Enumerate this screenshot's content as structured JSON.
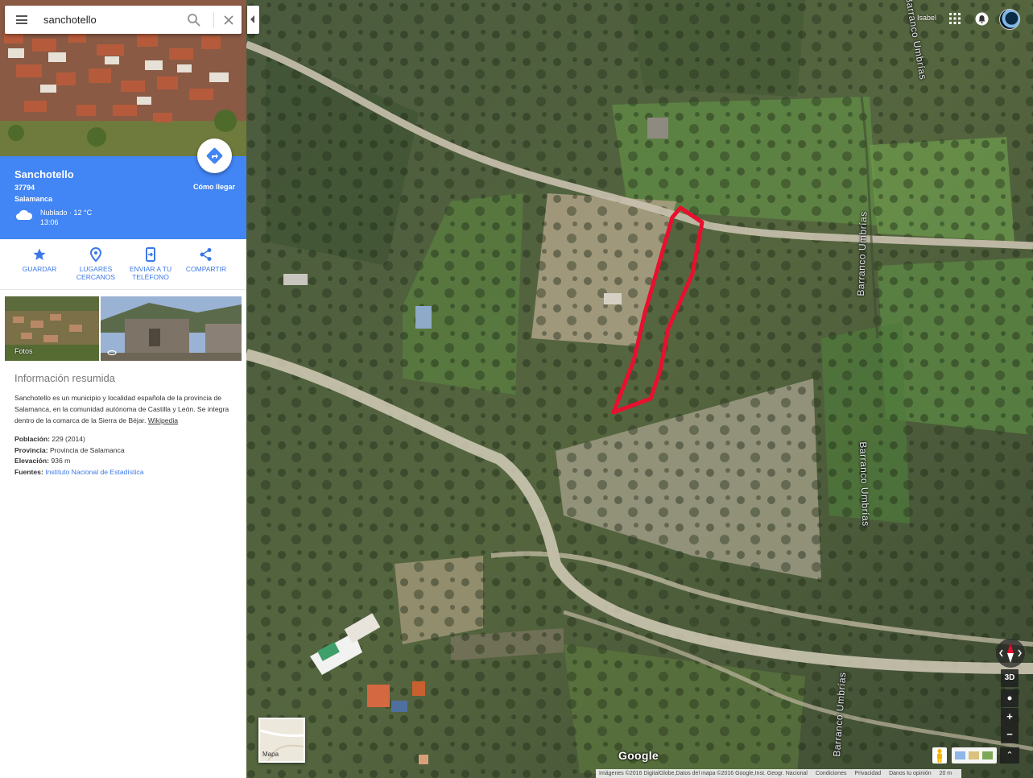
{
  "search": {
    "query": "sanchotello"
  },
  "place": {
    "name": "Sanchotello",
    "postal_code": "37794",
    "region": "Salamanca",
    "weather": "Nublado · 12 °C",
    "time": "13:06",
    "directions_label": "Cómo llegar"
  },
  "actions": [
    {
      "label": "GUARDAR",
      "icon": "star-icon"
    },
    {
      "label": "LUGARES CERCANOS",
      "icon": "location-pin-icon"
    },
    {
      "label": "ENVIAR A TU TELÉFONO",
      "icon": "send-to-phone-icon"
    },
    {
      "label": "COMPARTIR",
      "icon": "share-icon"
    }
  ],
  "photos": {
    "label": "Fotos"
  },
  "summary": {
    "title": "Información resumida",
    "text": "Sanchotello es un municipio y localidad española de la provincia de Salamanca, en la comunidad autónoma de Castilla y León. Se integra dentro de la comarca de la Sierra de Béjar.",
    "link": "Wikipedia",
    "facts": [
      {
        "label": "Población:",
        "value": "229 (2014)"
      },
      {
        "label": "Provincia:",
        "value": "Provincia de Salamanca"
      },
      {
        "label": "Elevación:",
        "value": "936 m"
      },
      {
        "label": "Fuentes:",
        "value": "Instituto Nacional de Estadística"
      }
    ]
  },
  "user": {
    "name": "Isabel"
  },
  "map": {
    "labels": [
      "Barranco Umbrías",
      "Barranco Umbrías",
      "Barranco Umbrías",
      "Barranco Umbrías"
    ],
    "minimap_label": "Mapa",
    "controls": {
      "tilt": "3D",
      "zoom_in": "+",
      "zoom_out": "−",
      "expand": "⌃"
    },
    "logo": "Google",
    "highlight_color": "#e8102f"
  },
  "footer": {
    "attribution": "Imágenes ©2016 DigitalGlobe,Datos del mapa ©2016 Google,Inst. Geogr. Nacional",
    "links": [
      "Condiciones",
      "Privacidad",
      "Danos tu opinión"
    ],
    "scale": "20 m"
  }
}
